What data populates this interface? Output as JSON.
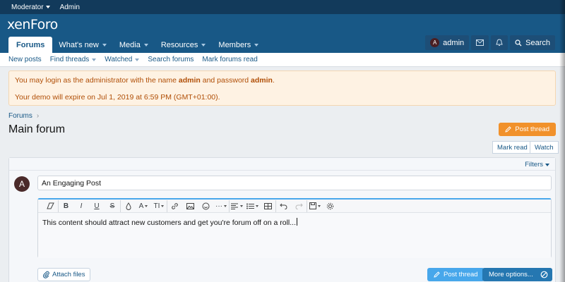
{
  "staffbar": {
    "moderator": "Moderator",
    "admin": "Admin"
  },
  "header": {
    "logo_a": "xen",
    "logo_b": "Foro"
  },
  "nav": {
    "tabs": [
      {
        "label": "Forums"
      },
      {
        "label": "What's new"
      },
      {
        "label": "Media"
      },
      {
        "label": "Resources"
      },
      {
        "label": "Members"
      }
    ],
    "account": "admin",
    "account_initial": "A",
    "search": "Search"
  },
  "subnav": {
    "items": [
      "New posts",
      "Find threads",
      "Watched",
      "Search forums",
      "Mark forums read"
    ]
  },
  "notice": {
    "line1_pre": "You may login as the administrator with the name ",
    "line1_user": "admin",
    "line1_mid": " and password ",
    "line1_pass": "admin",
    "line1_end": ".",
    "line2": "Your demo will expire on Jul 1, 2019 at 6:59 PM (GMT+01:00)."
  },
  "breadcrumb": {
    "item": "Forums",
    "sep": "›"
  },
  "page": {
    "title": "Main forum"
  },
  "actions": {
    "post_thread": "Post thread",
    "mark_read": "Mark read",
    "watch": "Watch"
  },
  "filters": {
    "label": "Filters"
  },
  "quick_thread": {
    "avatar_initial": "A",
    "title_value": "An Engaging Post",
    "body": "This content should attract new customers and get you're forum off on a roll...",
    "attach_label": "Attach files",
    "post_thread": "Post thread",
    "more_options": "More options..."
  },
  "toolbar": {
    "bold": "B",
    "italic": "I",
    "underline": "U",
    "strike": "S",
    "font": "A",
    "size": "TI"
  },
  "colors": {
    "staffbar": "#123a5b",
    "header": "#185886",
    "accent_orange": "#f1912b",
    "button_blue": "#47a7eb",
    "button_dark": "#2577b1",
    "notice_text": "#b04e06"
  }
}
